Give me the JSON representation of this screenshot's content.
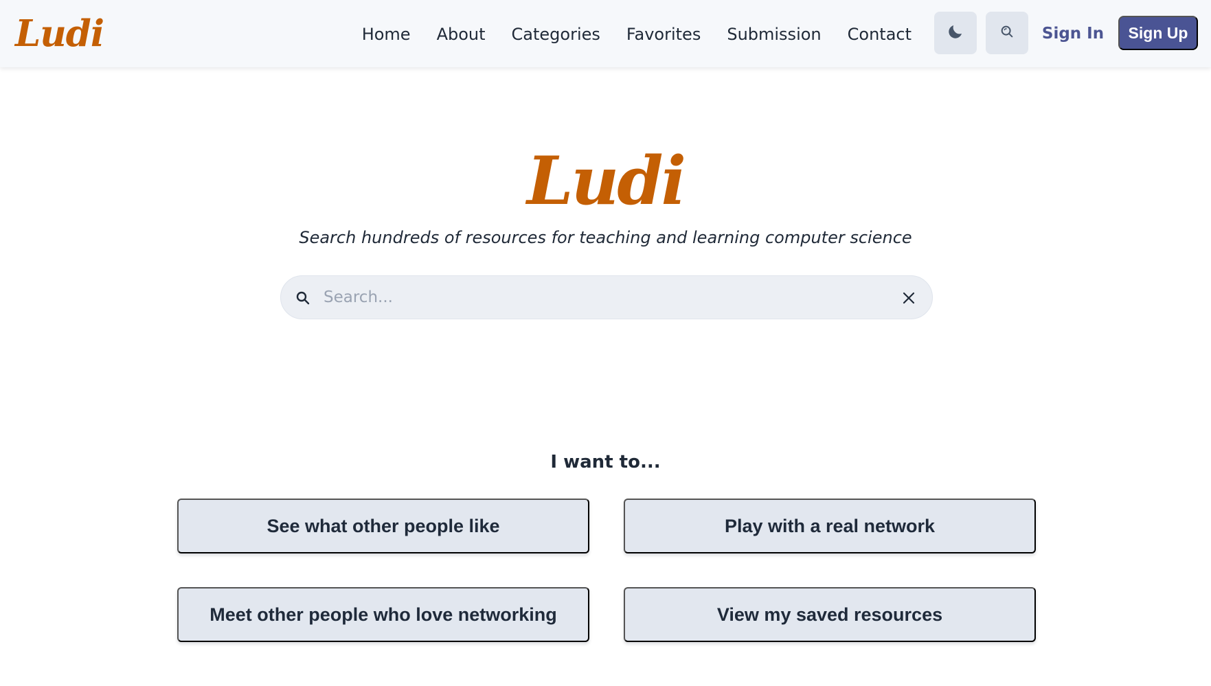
{
  "header": {
    "brand": "Ludi",
    "nav": [
      {
        "label": "Home"
      },
      {
        "label": "About"
      },
      {
        "label": "Categories"
      },
      {
        "label": "Favorites"
      },
      {
        "label": "Submission"
      },
      {
        "label": "Contact"
      }
    ],
    "theme_toggle_icon": "moon-icon",
    "search_button_icon": "search-icon",
    "sign_in_label": "Sign In",
    "sign_up_label": "Sign Up"
  },
  "hero": {
    "title": "Ludi",
    "subtitle": "Search hundreds of resources for teaching and learning computer science"
  },
  "search": {
    "placeholder": "Search...",
    "value": "",
    "lead_icon": "search-icon",
    "clear_icon": "close-icon"
  },
  "actions": {
    "heading": "I want to...",
    "items": [
      {
        "label": "See what other people like"
      },
      {
        "label": "Play with a real network"
      },
      {
        "label": "Meet other people who love networking"
      },
      {
        "label": "View my saved resources"
      }
    ]
  },
  "colors": {
    "brand": "#c45f04",
    "primary": "#4a5494",
    "navbar_bg": "#f6f8fb",
    "card_bg": "#e2e7ef",
    "search_bg": "#eceff4"
  }
}
